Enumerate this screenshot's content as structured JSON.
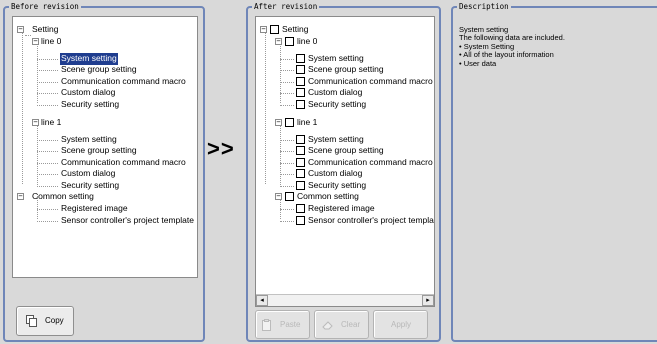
{
  "before": {
    "title": "Before revision",
    "tree": {
      "root": "Setting",
      "line0": "line 0",
      "line0_items": [
        "System setting",
        "Scene group setting",
        "Communication command macro",
        "Custom dialog",
        "Security setting"
      ],
      "line1": "line 1",
      "line1_items": [
        "System setting",
        "Scene group setting",
        "Communication command macro",
        "Custom dialog",
        "Security setting"
      ],
      "common": "Common setting",
      "common_items": [
        "Registered image",
        "Sensor controller's project template"
      ],
      "selected": "line 0 / System setting"
    },
    "copy_label": "Copy"
  },
  "arrow": ">>",
  "after": {
    "title": "After revision",
    "tree": {
      "root": "Setting",
      "line0": "line 0",
      "line0_items": [
        "System setting",
        "Scene group setting",
        "Communication command macro",
        "Custom dialog",
        "Security setting"
      ],
      "line1": "line 1",
      "line1_items": [
        "System setting",
        "Scene group setting",
        "Communication command macro",
        "Custom dialog",
        "Security setting"
      ],
      "common": "Common setting",
      "common_items": [
        "Registered image",
        "Sensor controller's project template"
      ]
    },
    "paste_label": "Paste",
    "clear_label": "Clear",
    "apply_label": "Apply"
  },
  "description": {
    "title": "Description",
    "text": "System setting\nThe following data are included.\n• System Setting\n• All of the layout information\n• User data"
  },
  "icons": {
    "copy": "copy-icon",
    "paste": "paste-icon",
    "clear": "eraser-icon"
  },
  "colors": {
    "group_border": "#6f86b8",
    "selection": "#1f3d8f"
  }
}
